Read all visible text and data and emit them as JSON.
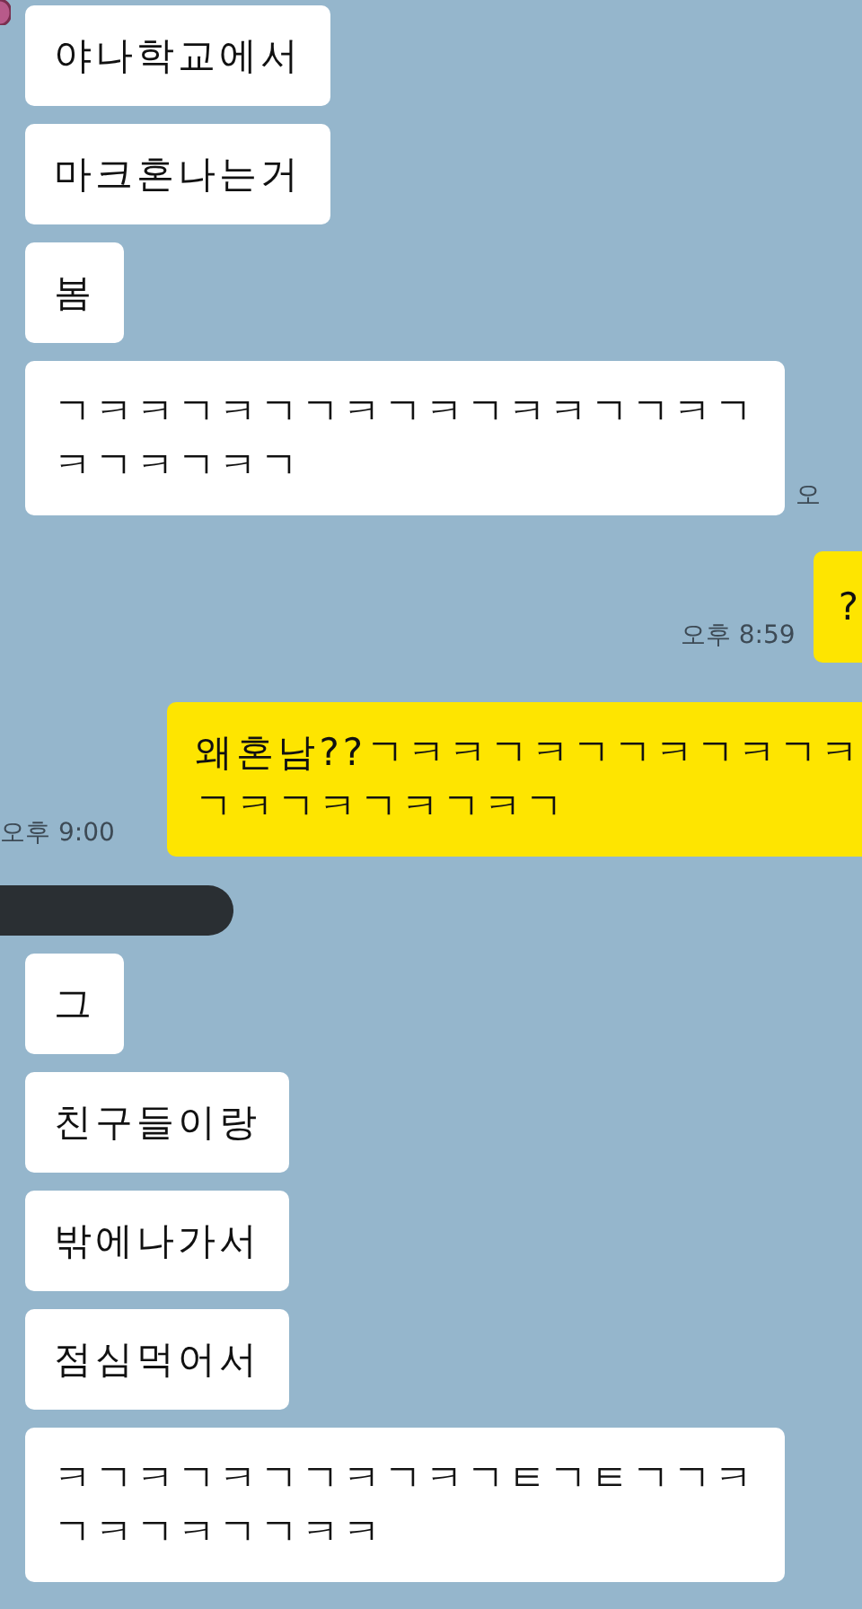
{
  "messages": [
    {
      "kind": "received",
      "lines": [
        "야나학교에서"
      ]
    },
    {
      "kind": "received",
      "lines": [
        "마크혼나는거"
      ]
    },
    {
      "kind": "received",
      "lines": [
        "봄"
      ]
    },
    {
      "kind": "received",
      "lines": [
        "ㄱㅋㅋㄱㅋㄱㄱㅋㄱㅋㄱㅋㅋㄱㄱㅋㄱ",
        "ㅋㄱㅋㄱㅋㄱ"
      ],
      "time": "오"
    },
    {
      "kind": "sent",
      "lines": [
        "?"
      ],
      "time": "오후 8:59"
    },
    {
      "kind": "sent",
      "lines": [
        "왜혼남??ㄱㅋㅋㄱㅋㄱㄱㅋㄱㅋㄱㅋ",
        "ㄱㅋㄱㅋㄱㅋㄱㅋㄱ"
      ],
      "time": "오후 9:00"
    },
    {
      "kind": "redacted"
    },
    {
      "kind": "received",
      "lines": [
        "그"
      ]
    },
    {
      "kind": "received",
      "lines": [
        "친구들이랑"
      ]
    },
    {
      "kind": "received",
      "lines": [
        "밖에나가서"
      ]
    },
    {
      "kind": "received",
      "lines": [
        "점심먹어서"
      ]
    },
    {
      "kind": "received",
      "lines": [
        "ㅋㄱㅋㄱㅋㄱㄱㅋㄱㅋㄱㅌㄱㅌㄱㄱㅋ",
        "ㄱㅋㄱㅋㄱㄱㅋㅋ"
      ]
    }
  ]
}
